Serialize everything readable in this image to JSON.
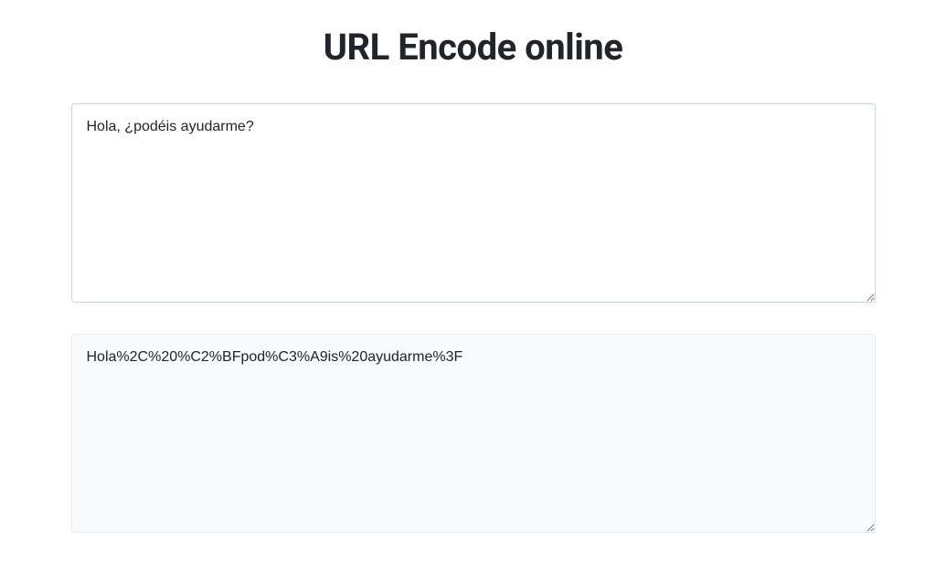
{
  "header": {
    "title": "URL Encode online"
  },
  "input": {
    "value": "Hola, ¿podéis ayudarme?"
  },
  "output": {
    "value": "Hola%2C%20%C2%BFpod%C3%A9is%20ayudarme%3F"
  }
}
